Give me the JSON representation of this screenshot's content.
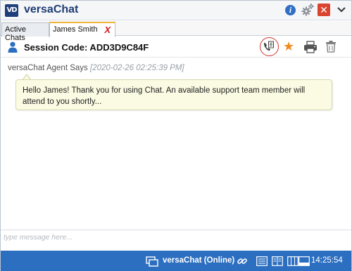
{
  "app": {
    "title": "versaChat",
    "logo_text": "VD"
  },
  "titlebar": {
    "info_icon": "info-icon",
    "settings_icon": "gear-icon",
    "close_glyph": "✕",
    "menu_icon": "dropdown-icon"
  },
  "tabs": [
    {
      "label": "Active Chats",
      "active": false
    },
    {
      "label": "James Smith",
      "active": true,
      "close_glyph": "X"
    }
  ],
  "session": {
    "label": "Session Code: ADD3D9C84F",
    "actions": [
      "phone-transcript-icon",
      "star-icon",
      "print-icon",
      "trash-icon"
    ],
    "star_glyph": "★"
  },
  "messages": [
    {
      "sender": "versaChat Agent Says",
      "timestamp": "[2020-02-26 02:25:39 PM]",
      "text": "Hello James! Thank you for using Chat. An available support team member will attend to you shortly..."
    }
  ],
  "compose": {
    "placeholder": "type message here...",
    "value": ""
  },
  "status": {
    "text": "versaChat (Online)",
    "time": "14:25:54"
  },
  "colors": {
    "accent": "#2c6fc1",
    "title": "#1d3b72",
    "bubble": "#fbfbe3",
    "close": "#d9432f",
    "star": "#f08a1c",
    "active_tab_border": "#f0b43a"
  }
}
